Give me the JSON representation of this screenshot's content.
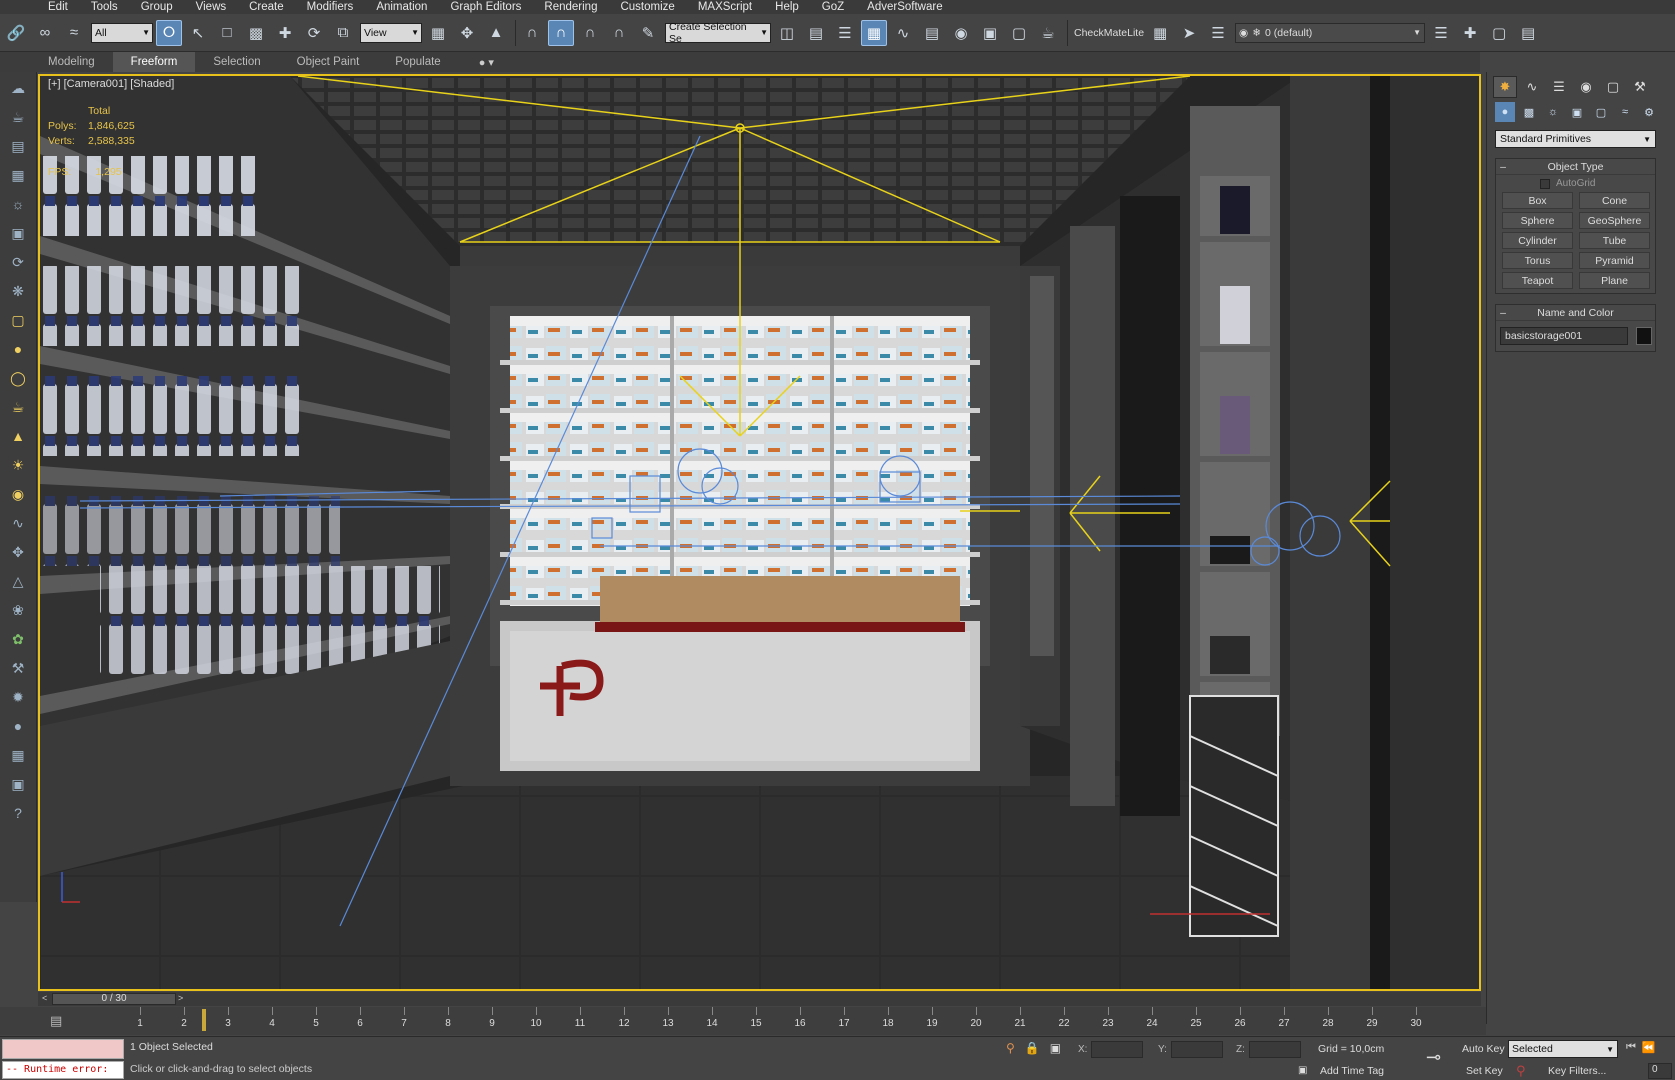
{
  "menu": [
    "Edit",
    "Tools",
    "Group",
    "Views",
    "Create",
    "Modifiers",
    "Animation",
    "Graph Editors",
    "Rendering",
    "Customize",
    "MAXScript",
    "Help",
    "GoZ",
    "AdverSoftware"
  ],
  "toolbar": {
    "selection_filter": "All",
    "ref_coord": "View",
    "named_selection_placeholder": "Create Selection Se",
    "checkmate_label": "CheckMateLite",
    "layer_value": "0 (default)"
  },
  "ribbon": {
    "tabs": [
      "Modeling",
      "Freeform",
      "Selection",
      "Object Paint",
      "Populate"
    ],
    "active": "Freeform"
  },
  "viewport": {
    "label": "[+] [Camera001] [Shaded]",
    "stats": [
      {
        "key": "",
        "value": "Total"
      },
      {
        "key": "Polys:",
        "value": "1,846,625"
      },
      {
        "key": "Verts:",
        "value": "2,588,335"
      }
    ],
    "fps_label": "FPS:",
    "fps_value": "1,295"
  },
  "command_panel": {
    "category": "Standard Primitives",
    "object_type_title": "Object Type",
    "autogrid_label": "AutoGrid",
    "object_buttons": [
      "Box",
      "Cone",
      "Sphere",
      "GeoSphere",
      "Cylinder",
      "Tube",
      "Torus",
      "Pyramid",
      "Teapot",
      "Plane"
    ],
    "name_color_title": "Name and Color",
    "object_name": "basicstorage001",
    "object_color": "#111111"
  },
  "time_slider": {
    "position": "0 / 30",
    "left_arrow": "<",
    "right_arrow": ">"
  },
  "track_bar": {
    "ticks": [
      1,
      2,
      3,
      4,
      5,
      6,
      7,
      8,
      9,
      10,
      11,
      12,
      13,
      14,
      15,
      16,
      17,
      18,
      19,
      20,
      21,
      22,
      23,
      24,
      25,
      26,
      27,
      28,
      29,
      30
    ]
  },
  "status": {
    "runtime_error": "-- Runtime error:",
    "selection_info": "1 Object Selected",
    "prompt": "Click or click-and-drag to select objects",
    "x_label": "X:",
    "y_label": "Y:",
    "z_label": "Z:",
    "grid": "Grid = 10,0cm",
    "add_time_tag": "Add Time Tag",
    "auto_key": "Auto Key",
    "set_key": "Set Key",
    "key_mode": "Selected",
    "key_filters": "Key Filters...",
    "current_frame": "0"
  },
  "colors": {
    "viewport_border": "#e8c21a",
    "camera_lines": "#e8d21a",
    "wire_blue": "#5a8ad8",
    "logo_red": "#8a1a1a",
    "active_tool": "#5a86b5"
  }
}
